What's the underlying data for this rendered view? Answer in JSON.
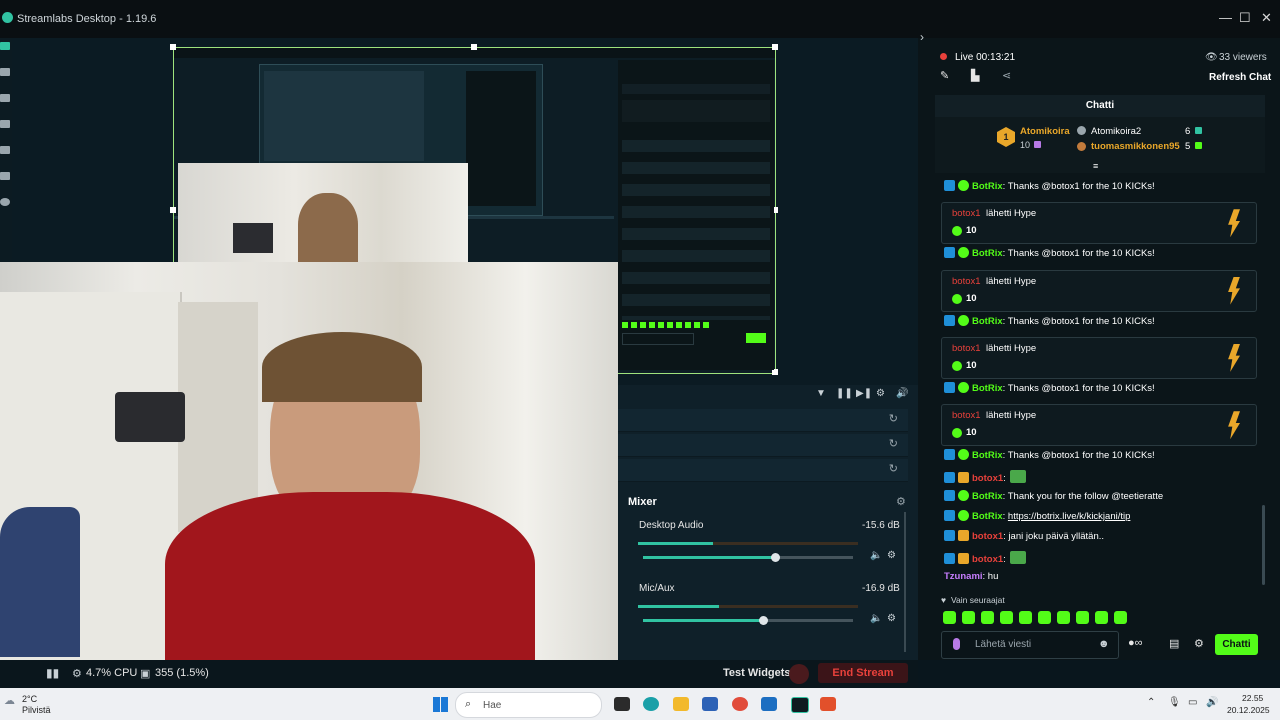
{
  "app": {
    "title": "Streamlabs Desktop - 1.19.6"
  },
  "window_controls": {
    "minimize": "—",
    "maximize": "☐",
    "close": "✕"
  },
  "editor": {
    "sources_tools": {
      "filter_icon": "▼",
      "pause_icon": "❚❚",
      "next_icon": "▶❚",
      "settings_icon": "⚙",
      "volume_icon": "🔊"
    }
  },
  "mixer": {
    "title": "Mixer",
    "channels": [
      {
        "name": "Desktop Audio",
        "db": "-15.6 dB",
        "level": 0.34,
        "fader": 0.63
      },
      {
        "name": "Mic/Aux",
        "db": "-16.9 dB",
        "level": 0.37,
        "fader": 0.57
      }
    ]
  },
  "status": {
    "cpu": "4.7% CPU",
    "frames": "355 (1.5%)",
    "test_widgets": "Test Widgets",
    "end_stream": "End Stream"
  },
  "chat": {
    "live": "Live 00:13:21",
    "viewers": "33 viewers",
    "refresh": "Refresh Chat",
    "header": "Chatti",
    "leaderboard": [
      {
        "rank": "1",
        "name": "Atomikoira",
        "score": "10"
      },
      {
        "name": "Atomikoira2",
        "score": "6"
      },
      {
        "name": "tuomasmikkonen95",
        "score": "5"
      }
    ],
    "messages": [
      {
        "kind": "bot",
        "user": "BotRix",
        "text": ": Thanks @botox1 for the 10 KICKs!"
      },
      {
        "kind": "hype",
        "user": "botox1",
        "text": " lähetti Hype",
        "amount": "10"
      },
      {
        "kind": "bot",
        "user": "BotRix",
        "text": ": Thanks @botox1 for the 10 KICKs!"
      },
      {
        "kind": "hype",
        "user": "botox1",
        "text": " lähetti Hype",
        "amount": "10"
      },
      {
        "kind": "bot",
        "user": "BotRix",
        "text": ": Thanks @botox1 for the 10 KICKs!"
      },
      {
        "kind": "hype",
        "user": "botox1",
        "text": " lähetti Hype",
        "amount": "10"
      },
      {
        "kind": "bot",
        "user": "BotRix",
        "text": ": Thanks @botox1 for the 10 KICKs!"
      },
      {
        "kind": "hype",
        "user": "botox1",
        "text": " lähetti Hype",
        "amount": "10"
      },
      {
        "kind": "bot",
        "user": "BotRix",
        "text": ": Thanks @botox1 for the 10 KICKs!"
      },
      {
        "kind": "user",
        "user": "botox1",
        "text": ":"
      },
      {
        "kind": "bot",
        "user": "BotRix",
        "text": ": Thank you for the follow @teetieratte"
      },
      {
        "kind": "bot",
        "user": "BotRix",
        "text": ": ",
        "link": "https://botrix.live/k/kickjani/tip"
      },
      {
        "kind": "user",
        "user": "botox1",
        "text": ": jani joku päivä yllätän.."
      },
      {
        "kind": "user",
        "user": "botox1",
        "text": ":"
      },
      {
        "kind": "plain",
        "user": "Tzunami",
        "text": ": hu"
      }
    ],
    "followers_only": "Vain seuraajat",
    "input_placeholder": "Lähetä viesti",
    "send": "Chatti"
  },
  "taskbar": {
    "weather_temp": "2°C",
    "weather_text": "Pilvistä",
    "search": "Hae",
    "time": "22.55",
    "date": "20.12.2025"
  },
  "colors": {
    "accent": "#53fc18",
    "live_red": "#e8413b",
    "bot_blue": "#1f8fd8"
  }
}
